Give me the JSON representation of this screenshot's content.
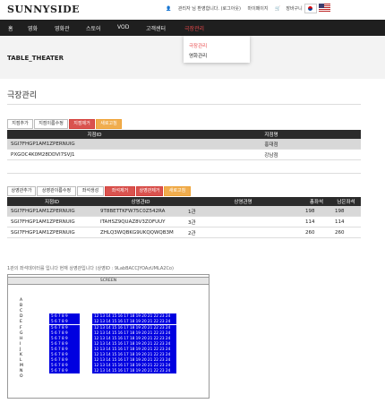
{
  "header": {
    "logo": "SUNNYSIDE",
    "welcome": "관리자 님 환영합니다. (로그아웃)",
    "mypage": "마이페이지",
    "cart": "장바구니",
    "flags": [
      "korean-flag-icon",
      "us-flag-icon"
    ]
  },
  "nav": {
    "items": [
      "홈",
      "영화",
      "영화관",
      "스토어",
      "VOD",
      "고객센터",
      "극장관리"
    ],
    "active_index": 6,
    "dropdown": [
      "극장관리",
      "영화관리"
    ]
  },
  "banner": {
    "title": "TABLE_THEATER"
  },
  "page": {
    "title": "극장관리"
  },
  "branch": {
    "buttons": [
      {
        "label": "지점추가",
        "style": "default"
      },
      {
        "label": "지점이름수정",
        "style": "default"
      },
      {
        "label": "지점제거",
        "style": "red"
      },
      {
        "label": "새로고침",
        "style": "orange"
      }
    ],
    "columns": [
      "지점ID",
      "지점명"
    ],
    "rows": [
      [
        "SGI7FHGP1AM1ZPERNUIG",
        "홍대점"
      ],
      [
        "PXGOC4K0M28DDVI7SVJ1",
        "강남점"
      ]
    ],
    "selected_index": 0
  },
  "hall": {
    "buttons": [
      {
        "label": "상영관추가",
        "style": "default"
      },
      {
        "label": "상영관이름수정",
        "style": "default"
      },
      {
        "label": "좌석생성",
        "style": "default"
      },
      {
        "label": "좌석제거",
        "style": "red"
      },
      {
        "label": "상영관제거",
        "style": "red"
      },
      {
        "label": "새로고침",
        "style": "orange"
      }
    ],
    "columns": [
      "지점ID",
      "상영관ID",
      "상영관명",
      "총좌석",
      "남은좌석"
    ],
    "rows": [
      [
        "SGI7FHGP1AM1ZPERNUIG",
        "9T8BETTKFW75C0Z542RA",
        "1관",
        "198",
        "198"
      ],
      [
        "SGI7FHGP1AM1ZPERNUIG",
        "ITAHSZ9QUAZ8V3ZOFUUY",
        "3관",
        "114",
        "114"
      ],
      [
        "SGI7FHGP1AM1ZPERNUIG",
        "ZHLQ3WQBKG9UKQQWQB3M",
        "2관",
        "260",
        "260"
      ]
    ],
    "selected_index": 0
  },
  "seatmap": {
    "info": "1관의 좌석데이터를 입니다 현재 상영관입니다 (상영ID : 9LabBACCJYOAzUMLA2Co)",
    "screen_label": "SCREEN",
    "row_labels": [
      "A",
      "B",
      "C",
      "D",
      "E",
      "F",
      "G",
      "H",
      "I",
      "J",
      "K",
      "L",
      "M",
      "N",
      "O"
    ],
    "left_block": "5 6 7 8 9",
    "right_block": "12 13 14 15 16 17 18 19 20 21 22 23 24",
    "seat_color": "#0000e0"
  }
}
